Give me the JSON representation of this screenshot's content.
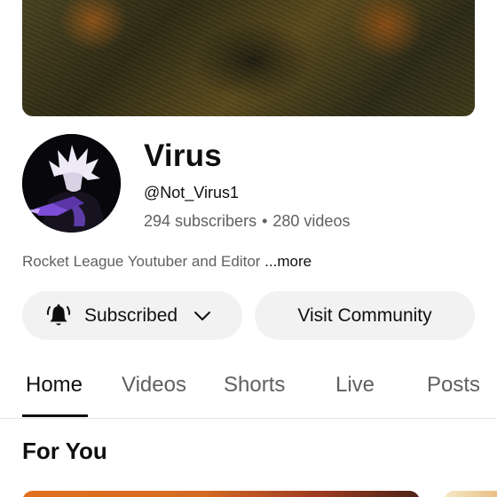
{
  "channel": {
    "name": "Virus",
    "handle": "@Not_Virus1",
    "subscribers": "294 subscribers",
    "separator": "•",
    "videos": "280 videos",
    "description": "Rocket League Youtuber and Editor",
    "more_label": "...more"
  },
  "actions": {
    "subscribed_label": "Subscribed",
    "visit_label": "Visit Community"
  },
  "tabs": [
    {
      "label": "Home",
      "active": true
    },
    {
      "label": "Videos",
      "active": false
    },
    {
      "label": "Shorts",
      "active": false
    },
    {
      "label": "Live",
      "active": false
    },
    {
      "label": "Posts",
      "active": false
    }
  ],
  "section": {
    "title": "For You"
  },
  "icons": {
    "subscribed": "bell-ringing-icon",
    "dropdown": "chevron-down-icon"
  },
  "colors": {
    "text_primary": "#0f0f0f",
    "text_secondary": "#606060",
    "button_bg": "#f2f2f2"
  }
}
